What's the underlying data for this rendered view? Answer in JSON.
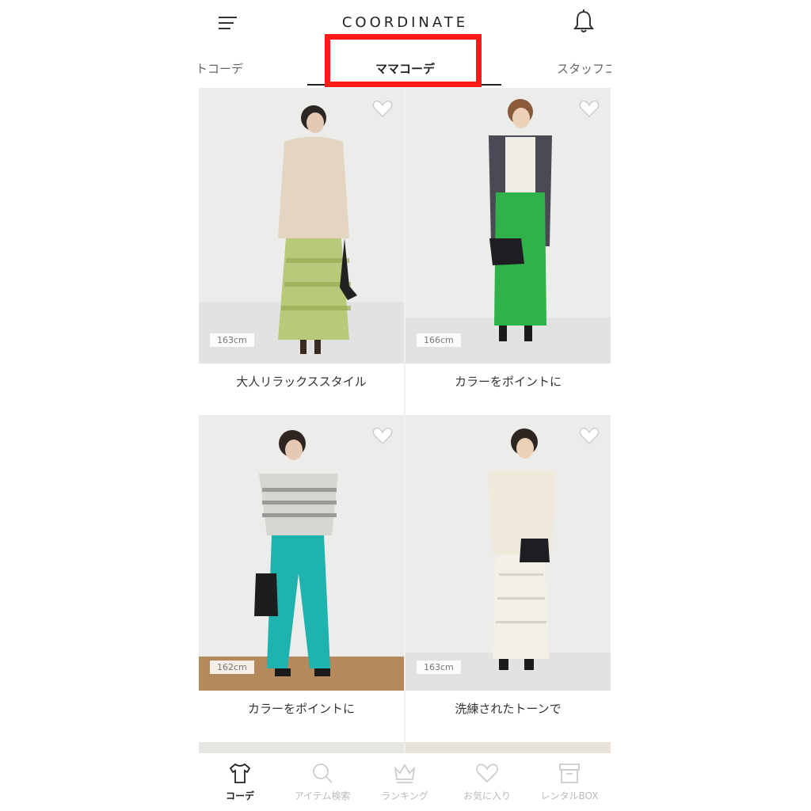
{
  "header": {
    "brand": "COORDINATE",
    "menu_icon": "hamburger-menu-icon",
    "notification_icon": "bell-icon"
  },
  "tabs": {
    "left_label": "トコーデ",
    "active_label": "ママコーデ",
    "right_label": "スタッフコ"
  },
  "highlight_color": "#ff1a1a",
  "cards": [
    {
      "height": "163cm",
      "title": "大人リラックススタイル"
    },
    {
      "height": "166cm",
      "title": "カラーをポイントに"
    },
    {
      "height": "162cm",
      "title": "カラーをポイントに"
    },
    {
      "height": "163cm",
      "title": "洗練されたトーンで"
    }
  ],
  "bottom_nav": [
    {
      "label": "コーデ",
      "icon": "tshirt-icon",
      "active": true
    },
    {
      "label": "アイテム検索",
      "icon": "search-icon",
      "active": false
    },
    {
      "label": "ランキング",
      "icon": "crown-icon",
      "active": false
    },
    {
      "label": "お気に入り",
      "icon": "heart-icon",
      "active": false
    },
    {
      "label": "レンタルBOX",
      "icon": "box-icon",
      "active": false
    }
  ]
}
